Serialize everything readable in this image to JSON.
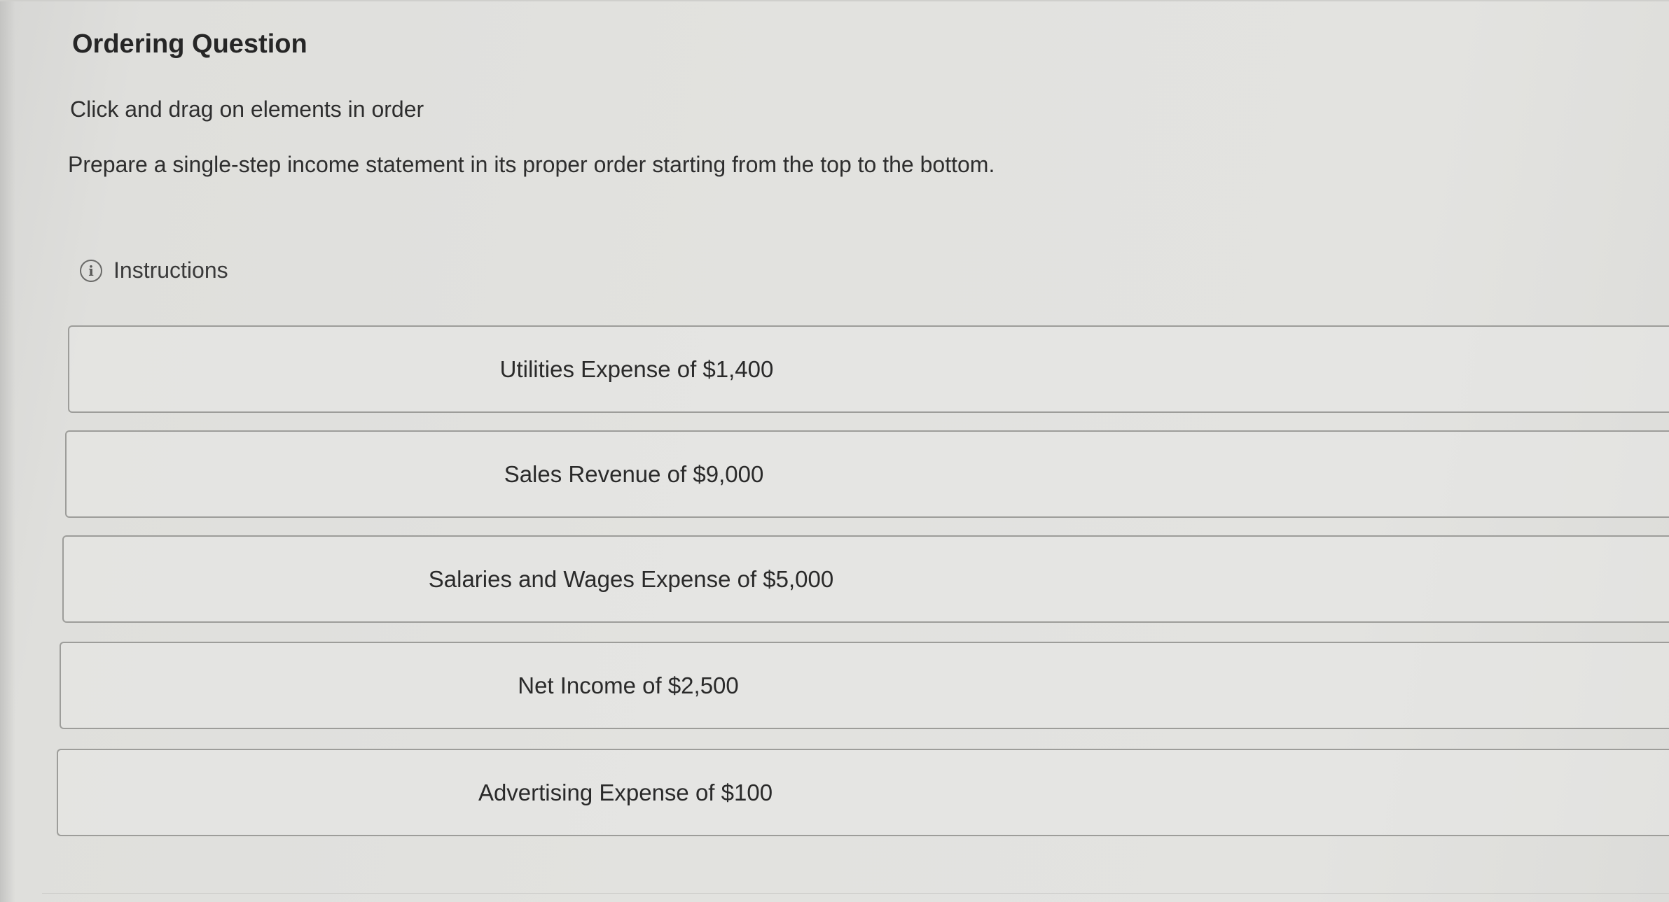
{
  "question": {
    "title": "Ordering Question",
    "sub_instruction": "Click and drag on elements in order",
    "prompt": "Prepare a single-step income statement in its proper order starting from the top to the bottom.",
    "instructions_label": "Instructions",
    "instructions_icon": "info-icon"
  },
  "items": [
    {
      "label": "Utilities Expense of $1,400"
    },
    {
      "label": "Sales Revenue of $9,000"
    },
    {
      "label": "Salaries and Wages Expense of $5,000"
    },
    {
      "label": "Net Income of $2,500"
    },
    {
      "label": "Advertising Expense of $100"
    }
  ],
  "colors": {
    "background": "#e2e2df",
    "item_border": "#9d9d9a",
    "text": "#2b2b2b"
  }
}
